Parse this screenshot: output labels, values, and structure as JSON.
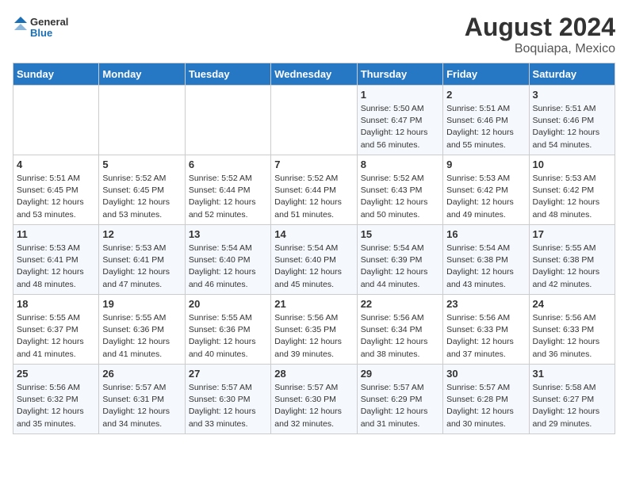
{
  "logo": {
    "line1": "General",
    "line2": "Blue"
  },
  "title": "August 2024",
  "location": "Boquiapa, Mexico",
  "days_of_week": [
    "Sunday",
    "Monday",
    "Tuesday",
    "Wednesday",
    "Thursday",
    "Friday",
    "Saturday"
  ],
  "weeks": [
    [
      {
        "num": "",
        "info": ""
      },
      {
        "num": "",
        "info": ""
      },
      {
        "num": "",
        "info": ""
      },
      {
        "num": "",
        "info": ""
      },
      {
        "num": "1",
        "info": "Sunrise: 5:50 AM\nSunset: 6:47 PM\nDaylight: 12 hours\nand 56 minutes."
      },
      {
        "num": "2",
        "info": "Sunrise: 5:51 AM\nSunset: 6:46 PM\nDaylight: 12 hours\nand 55 minutes."
      },
      {
        "num": "3",
        "info": "Sunrise: 5:51 AM\nSunset: 6:46 PM\nDaylight: 12 hours\nand 54 minutes."
      }
    ],
    [
      {
        "num": "4",
        "info": "Sunrise: 5:51 AM\nSunset: 6:45 PM\nDaylight: 12 hours\nand 53 minutes."
      },
      {
        "num": "5",
        "info": "Sunrise: 5:52 AM\nSunset: 6:45 PM\nDaylight: 12 hours\nand 53 minutes."
      },
      {
        "num": "6",
        "info": "Sunrise: 5:52 AM\nSunset: 6:44 PM\nDaylight: 12 hours\nand 52 minutes."
      },
      {
        "num": "7",
        "info": "Sunrise: 5:52 AM\nSunset: 6:44 PM\nDaylight: 12 hours\nand 51 minutes."
      },
      {
        "num": "8",
        "info": "Sunrise: 5:52 AM\nSunset: 6:43 PM\nDaylight: 12 hours\nand 50 minutes."
      },
      {
        "num": "9",
        "info": "Sunrise: 5:53 AM\nSunset: 6:42 PM\nDaylight: 12 hours\nand 49 minutes."
      },
      {
        "num": "10",
        "info": "Sunrise: 5:53 AM\nSunset: 6:42 PM\nDaylight: 12 hours\nand 48 minutes."
      }
    ],
    [
      {
        "num": "11",
        "info": "Sunrise: 5:53 AM\nSunset: 6:41 PM\nDaylight: 12 hours\nand 48 minutes."
      },
      {
        "num": "12",
        "info": "Sunrise: 5:53 AM\nSunset: 6:41 PM\nDaylight: 12 hours\nand 47 minutes."
      },
      {
        "num": "13",
        "info": "Sunrise: 5:54 AM\nSunset: 6:40 PM\nDaylight: 12 hours\nand 46 minutes."
      },
      {
        "num": "14",
        "info": "Sunrise: 5:54 AM\nSunset: 6:40 PM\nDaylight: 12 hours\nand 45 minutes."
      },
      {
        "num": "15",
        "info": "Sunrise: 5:54 AM\nSunset: 6:39 PM\nDaylight: 12 hours\nand 44 minutes."
      },
      {
        "num": "16",
        "info": "Sunrise: 5:54 AM\nSunset: 6:38 PM\nDaylight: 12 hours\nand 43 minutes."
      },
      {
        "num": "17",
        "info": "Sunrise: 5:55 AM\nSunset: 6:38 PM\nDaylight: 12 hours\nand 42 minutes."
      }
    ],
    [
      {
        "num": "18",
        "info": "Sunrise: 5:55 AM\nSunset: 6:37 PM\nDaylight: 12 hours\nand 41 minutes."
      },
      {
        "num": "19",
        "info": "Sunrise: 5:55 AM\nSunset: 6:36 PM\nDaylight: 12 hours\nand 41 minutes."
      },
      {
        "num": "20",
        "info": "Sunrise: 5:55 AM\nSunset: 6:36 PM\nDaylight: 12 hours\nand 40 minutes."
      },
      {
        "num": "21",
        "info": "Sunrise: 5:56 AM\nSunset: 6:35 PM\nDaylight: 12 hours\nand 39 minutes."
      },
      {
        "num": "22",
        "info": "Sunrise: 5:56 AM\nSunset: 6:34 PM\nDaylight: 12 hours\nand 38 minutes."
      },
      {
        "num": "23",
        "info": "Sunrise: 5:56 AM\nSunset: 6:33 PM\nDaylight: 12 hours\nand 37 minutes."
      },
      {
        "num": "24",
        "info": "Sunrise: 5:56 AM\nSunset: 6:33 PM\nDaylight: 12 hours\nand 36 minutes."
      }
    ],
    [
      {
        "num": "25",
        "info": "Sunrise: 5:56 AM\nSunset: 6:32 PM\nDaylight: 12 hours\nand 35 minutes."
      },
      {
        "num": "26",
        "info": "Sunrise: 5:57 AM\nSunset: 6:31 PM\nDaylight: 12 hours\nand 34 minutes."
      },
      {
        "num": "27",
        "info": "Sunrise: 5:57 AM\nSunset: 6:30 PM\nDaylight: 12 hours\nand 33 minutes."
      },
      {
        "num": "28",
        "info": "Sunrise: 5:57 AM\nSunset: 6:30 PM\nDaylight: 12 hours\nand 32 minutes."
      },
      {
        "num": "29",
        "info": "Sunrise: 5:57 AM\nSunset: 6:29 PM\nDaylight: 12 hours\nand 31 minutes."
      },
      {
        "num": "30",
        "info": "Sunrise: 5:57 AM\nSunset: 6:28 PM\nDaylight: 12 hours\nand 30 minutes."
      },
      {
        "num": "31",
        "info": "Sunrise: 5:58 AM\nSunset: 6:27 PM\nDaylight: 12 hours\nand 29 minutes."
      }
    ]
  ]
}
